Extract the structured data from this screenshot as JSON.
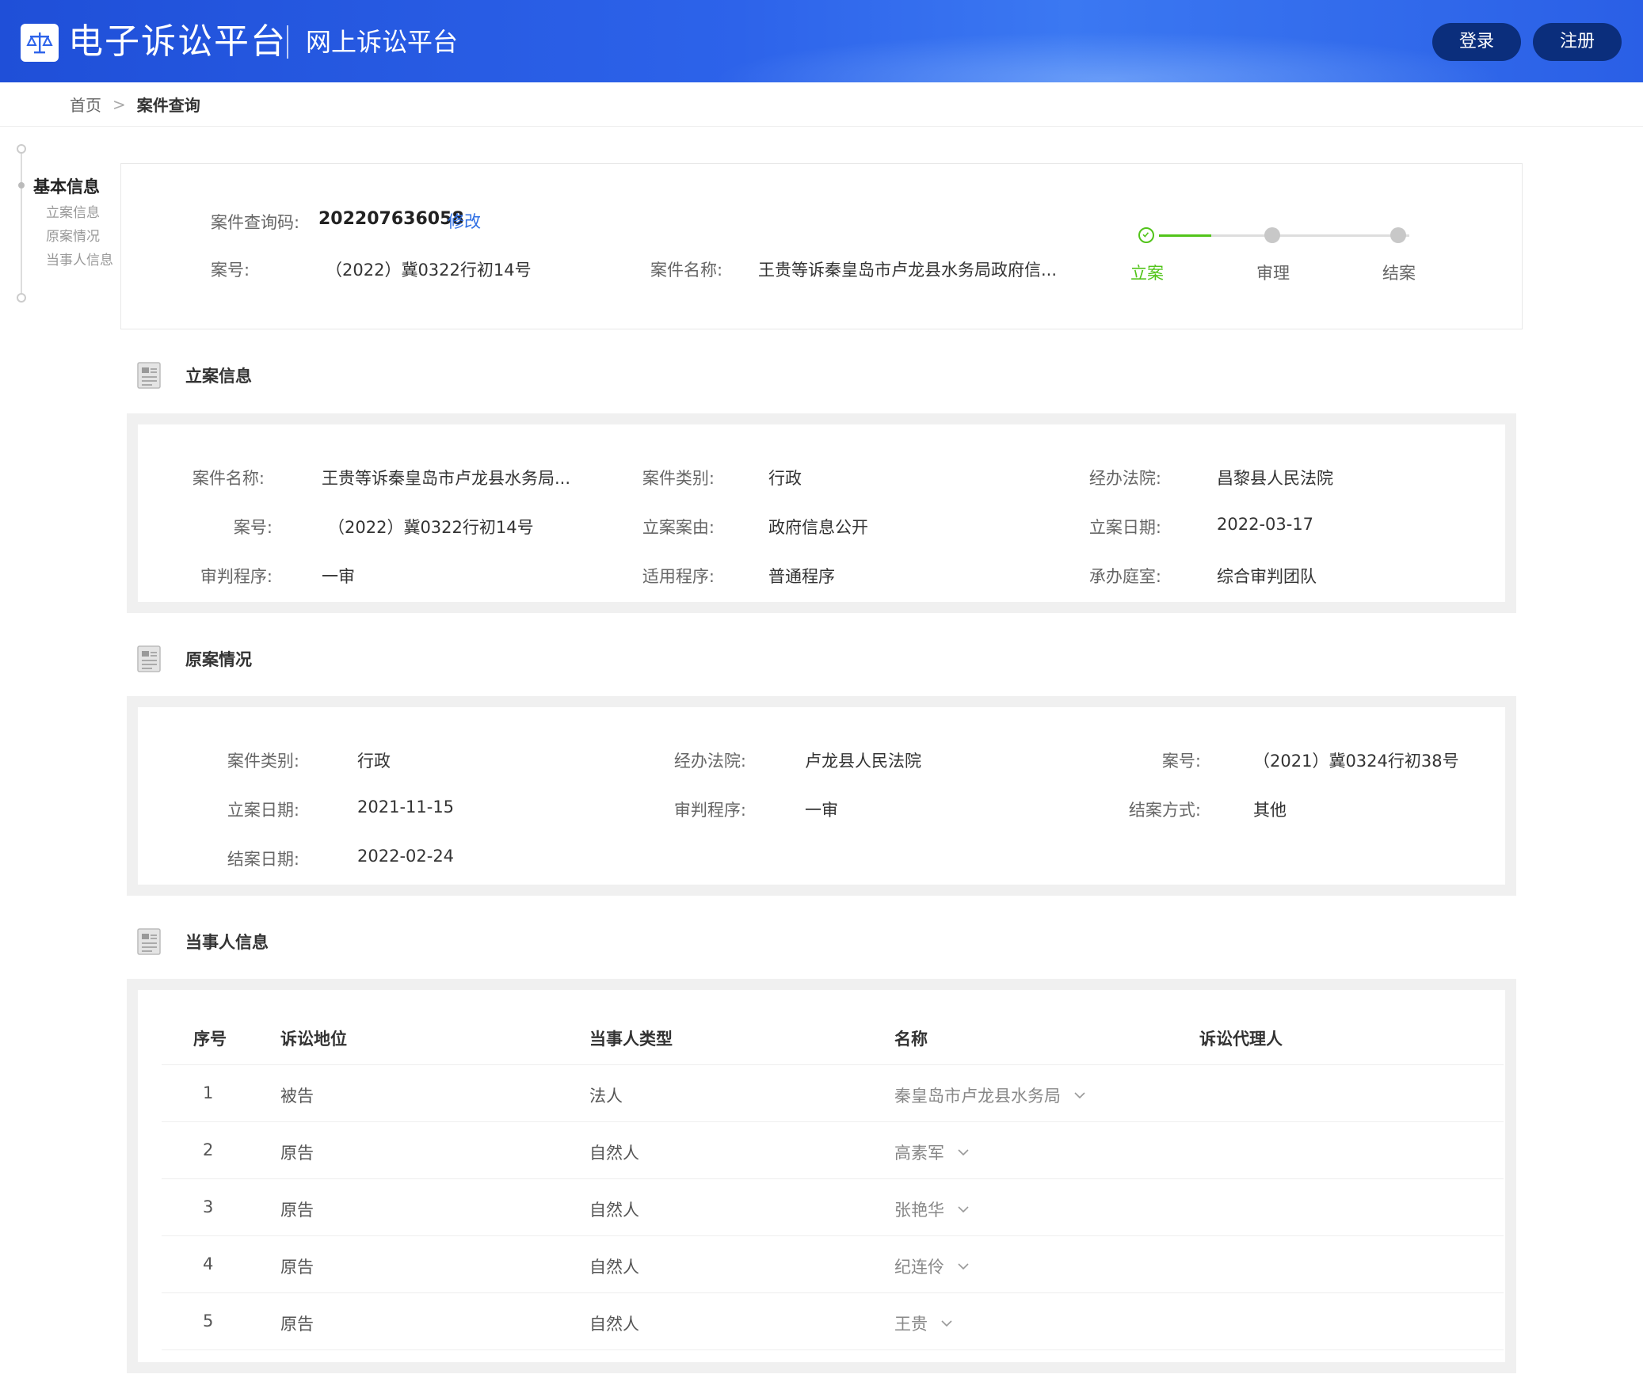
{
  "header": {
    "brand": "电子诉讼平台",
    "subtitle": "网上诉讼平台",
    "logo_icon": "scales-icon",
    "login_label": "登录",
    "register_label": "注册"
  },
  "breadcrumb": {
    "home": "首页",
    "separator": ">",
    "current": "案件查询"
  },
  "anchor_nav": {
    "main": "基本信息",
    "items": [
      "立案信息",
      "原案情况",
      "当事人信息"
    ]
  },
  "summary": {
    "query_code_label": "案件查询码:",
    "query_code": "202207636058",
    "edit_label": "修改",
    "case_no_label": "案号:",
    "case_no": "（2022）冀0322行初14号",
    "case_name_label": "案件名称:",
    "case_name": "王贵等诉秦皇岛市卢龙县水务局政府信...",
    "steps": [
      {
        "label": "立案",
        "status": "done"
      },
      {
        "label": "审理",
        "status": "pending"
      },
      {
        "label": "结案",
        "status": "pending"
      }
    ]
  },
  "filing": {
    "title": "立案信息",
    "fields": [
      {
        "label": "案件名称:",
        "value": "王贵等诉秦皇岛市卢龙县水务局..."
      },
      {
        "label": "案件类别:",
        "value": "行政"
      },
      {
        "label": "经办法院:",
        "value": "昌黎县人民法院"
      },
      {
        "label": "案号:",
        "value": "（2022）冀0322行初14号"
      },
      {
        "label": "立案案由:",
        "value": "政府信息公开"
      },
      {
        "label": "立案日期:",
        "value": "2022-03-17"
      },
      {
        "label": "审判程序:",
        "value": "一审"
      },
      {
        "label": "适用程序:",
        "value": "普通程序"
      },
      {
        "label": "承办庭室:",
        "value": "综合审判团队"
      }
    ]
  },
  "original": {
    "title": "原案情况",
    "fields": [
      {
        "label": "案件类别:",
        "value": "行政"
      },
      {
        "label": "经办法院:",
        "value": "卢龙县人民法院"
      },
      {
        "label": "案号:",
        "value": "（2021）冀0324行初38号"
      },
      {
        "label": "立案日期:",
        "value": "2021-11-15"
      },
      {
        "label": "审判程序:",
        "value": "一审"
      },
      {
        "label": "结案方式:",
        "value": "其他"
      },
      {
        "label": "结案日期:",
        "value": "2022-02-24"
      }
    ]
  },
  "parties": {
    "title": "当事人信息",
    "columns": [
      "序号",
      "诉讼地位",
      "当事人类型",
      "名称",
      "诉讼代理人"
    ],
    "rows": [
      {
        "no": "1",
        "role": "被告",
        "type": "法人",
        "name": "秦皇岛市卢龙县水务局",
        "agent": ""
      },
      {
        "no": "2",
        "role": "原告",
        "type": "自然人",
        "name": "高素军",
        "agent": ""
      },
      {
        "no": "3",
        "role": "原告",
        "type": "自然人",
        "name": "张艳华",
        "agent": ""
      },
      {
        "no": "4",
        "role": "原告",
        "type": "自然人",
        "name": "纪连伶",
        "agent": ""
      },
      {
        "no": "5",
        "role": "原告",
        "type": "自然人",
        "name": "王贵",
        "agent": ""
      }
    ]
  },
  "colors": {
    "header_blue": "#2d63ea",
    "button_navy": "#0b2e7c",
    "link_blue": "#2f6fe4",
    "step_done": "#52c41a",
    "step_pending": "#bfbfbf"
  }
}
